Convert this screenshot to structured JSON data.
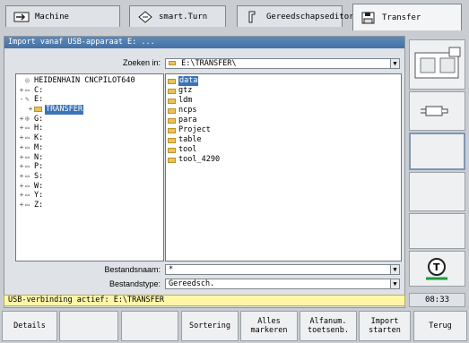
{
  "tabs": [
    {
      "label": "Machine",
      "icon": "arrow-right-box-icon"
    },
    {
      "label": "smart.Turn",
      "icon": "diamond-arrow-icon"
    },
    {
      "label": "Gereedschapseditor",
      "icon": "tool-holder-icon"
    },
    {
      "label": "Transfer",
      "icon": "floppy-disk-icon"
    }
  ],
  "dialog": {
    "title": "Import vanaf USB-apparaat E: ...",
    "search_label": "Zoeken in:",
    "search_value": "E:\\TRANSFER\\",
    "filename_label": "Bestandsnaam:",
    "filename_value": "*",
    "filetype_label": "Bestandstype:",
    "filetype_value": "Gereedsch."
  },
  "tree": [
    {
      "label": "HEIDENHAIN CNCPILOT640",
      "pm": "",
      "icon": "root"
    },
    {
      "label": "C:",
      "pm": "+",
      "icon": "drive"
    },
    {
      "label": "E:",
      "pm": "-",
      "icon": "usb"
    },
    {
      "label": "TRANSFER",
      "pm": "+",
      "icon": "folder",
      "indent": true,
      "selected": true
    },
    {
      "label": "G:",
      "pm": "+",
      "icon": "network"
    },
    {
      "label": "H:",
      "pm": "+",
      "icon": "net"
    },
    {
      "label": "K:",
      "pm": "+",
      "icon": "net"
    },
    {
      "label": "M:",
      "pm": "+",
      "icon": "net"
    },
    {
      "label": "N:",
      "pm": "+",
      "icon": "net"
    },
    {
      "label": "P:",
      "pm": "+",
      "icon": "net"
    },
    {
      "label": "S:",
      "pm": "+",
      "icon": "net"
    },
    {
      "label": "W:",
      "pm": "+",
      "icon": "net"
    },
    {
      "label": "Y:",
      "pm": "+",
      "icon": "net"
    },
    {
      "label": "Z:",
      "pm": "+",
      "icon": "net"
    }
  ],
  "files": [
    "data",
    "gtz",
    "ldm",
    "ncps",
    "para",
    "Project",
    "table",
    "tool",
    "tool_4290"
  ],
  "status": "USB-verbinding actief: E:\\TRANSFER",
  "clock": "08:33",
  "softkeys": [
    "Details",
    "",
    "",
    "Sortering",
    "Alles\nmarkeren",
    "Alfanum.\ntoetsenb.",
    "Import\nstarten",
    "Terug"
  ]
}
